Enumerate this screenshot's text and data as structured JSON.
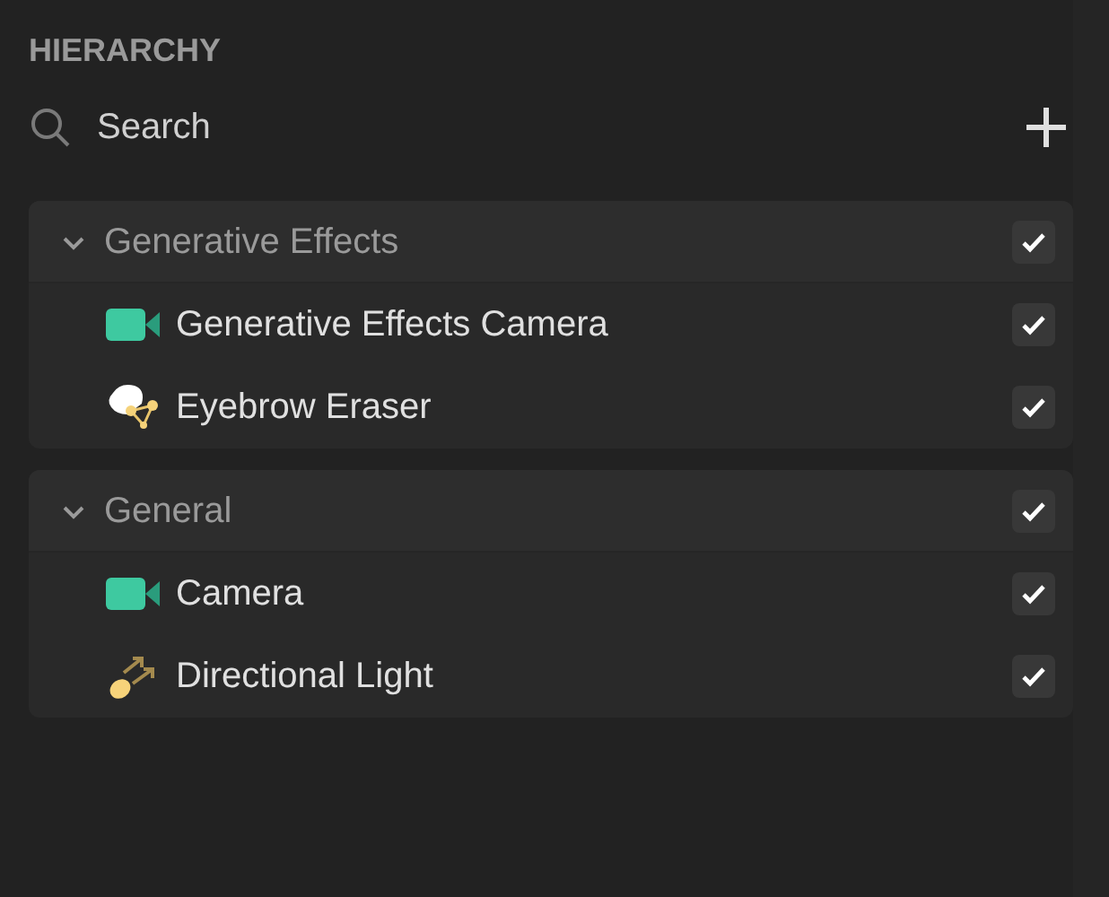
{
  "panel": {
    "title": "HIERARCHY"
  },
  "search": {
    "placeholder": "Search"
  },
  "groups": [
    {
      "name": "Generative Effects",
      "expanded": true,
      "checked": true,
      "children": [
        {
          "name": "Generative Effects Camera",
          "kind": "camera",
          "checked": true
        },
        {
          "name": "Eyebrow Eraser",
          "kind": "face",
          "checked": true
        }
      ]
    },
    {
      "name": "General",
      "expanded": true,
      "checked": true,
      "children": [
        {
          "name": "Camera",
          "kind": "camera",
          "checked": true
        },
        {
          "name": "Directional Light",
          "kind": "light",
          "checked": true
        }
      ]
    }
  ]
}
